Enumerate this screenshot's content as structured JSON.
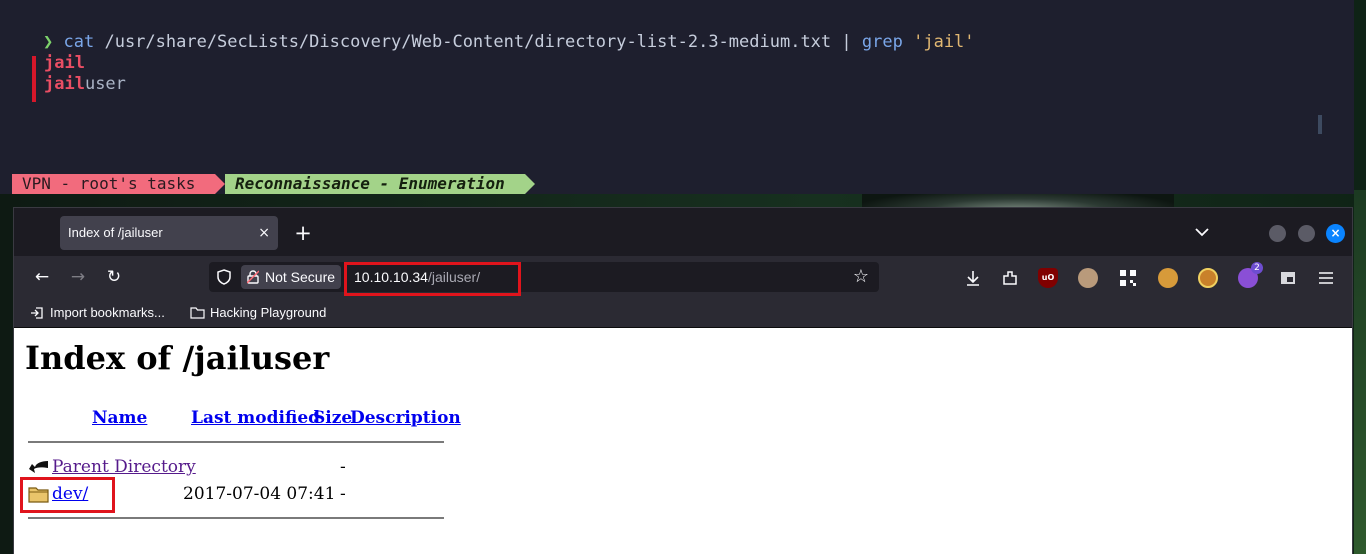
{
  "terminal": {
    "prompt_symbol": "❯",
    "command": {
      "cat": "cat",
      "path": "/usr/share/SecLists/Discovery/Web-Content/directory-list-2.3-medium.txt",
      "pipe": "|",
      "grep": "grep",
      "arg": "'jail'"
    },
    "output": [
      {
        "match": "jail",
        "rest": ""
      },
      {
        "match": "jail",
        "rest": "user"
      }
    ],
    "status": {
      "left_segment": "VPN - root's tasks",
      "right_segment": "Reconnaissance - Enumeration"
    }
  },
  "browser": {
    "tab_title": "Index of /jailuser",
    "tab_close": "×",
    "new_tab": "+",
    "window_close": "×",
    "nav": {
      "back": "←",
      "forward": "→",
      "reload": "↻"
    },
    "address": {
      "security_label": "Not Secure",
      "host": "10.10.10.34",
      "path": "/jailuser/"
    },
    "bookmark_star": "☆",
    "extension_badge_count": "2",
    "toolbar_icons": [
      "downloads-icon",
      "extensions-icon",
      "ublock-origin-icon",
      "extension-face-icon",
      "qr-code-icon",
      "cookie-icon",
      "extension-cookie-icon",
      "extension-badge-icon",
      "extension-pip-icon",
      "menu-icon"
    ],
    "bookmarks": [
      {
        "label": "Import bookmarks...",
        "icon": "import-icon"
      },
      {
        "label": "Hacking Playground",
        "icon": "folder-icon"
      }
    ]
  },
  "page": {
    "title": "Index of /jailuser",
    "columns": {
      "name": "Name",
      "last_modified": "Last modified",
      "size": "Size",
      "description": "Description"
    },
    "rows": [
      {
        "name": "Parent Directory",
        "modified": "",
        "size": "-",
        "icon": "back-arrow-icon"
      },
      {
        "name": "dev/",
        "modified": "2017-07-04 07:41",
        "size": "-",
        "icon": "folder-icon"
      }
    ]
  },
  "colors": {
    "highlight_box": "#e0141c",
    "link": "#0000ee",
    "visited_link": "#551a8b",
    "status_red": "#f26b7d",
    "status_green": "#a3d389"
  }
}
